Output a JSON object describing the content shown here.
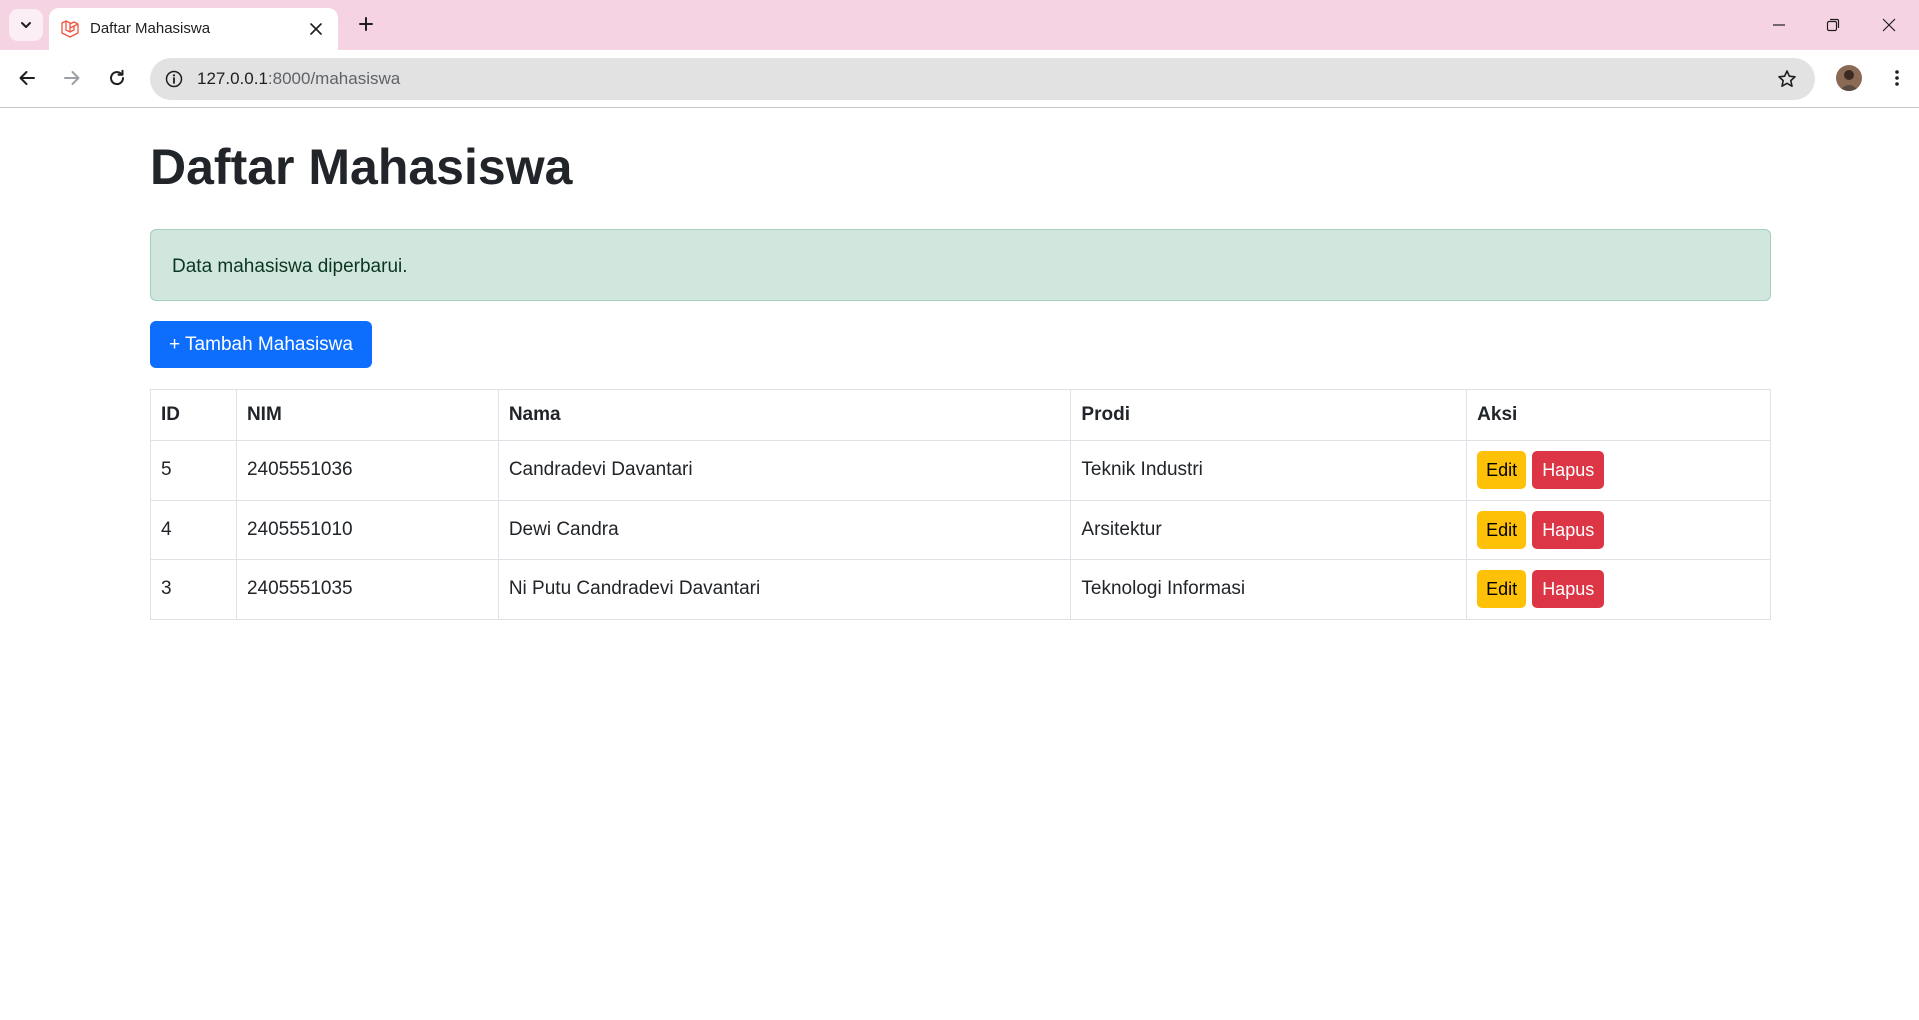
{
  "browser": {
    "tab_title": "Daftar Mahasiswa",
    "url_host": "127.0.0.1",
    "url_path": ":8000/mahasiswa"
  },
  "page": {
    "title": "Daftar Mahasiswa",
    "alert": "Data mahasiswa diperbarui.",
    "add_button": "+ Tambah Mahasiswa"
  },
  "table": {
    "headers": [
      "ID",
      "NIM",
      "Nama",
      "Prodi",
      "Aksi"
    ],
    "rows": [
      {
        "id": "5",
        "nim": "2405551036",
        "nama": "Candradevi Davantari",
        "prodi": "Teknik Industri",
        "edit": "Edit",
        "hapus": "Hapus"
      },
      {
        "id": "4",
        "nim": "2405551010",
        "nama": "Dewi Candra",
        "prodi": "Arsitektur",
        "edit": "Edit",
        "hapus": "Hapus"
      },
      {
        "id": "3",
        "nim": "2405551035",
        "nama": "Ni Putu Candradevi Davantari",
        "prodi": "Teknologi Informasi",
        "edit": "Edit",
        "hapus": "Hapus"
      }
    ]
  },
  "colors": {
    "primary": "#0d6efd",
    "warning": "#ffc107",
    "danger": "#dc3545",
    "success_bg": "#d1e7dd",
    "tabbar_bg": "#f6d3e3"
  },
  "icons": [
    "tab-search-icon",
    "laravel-favicon-icon",
    "close-icon",
    "plus-icon",
    "minimize-icon",
    "restore-icon",
    "window-close-icon",
    "back-icon",
    "forward-icon",
    "reload-icon",
    "site-info-icon",
    "bookmark-star-icon",
    "profile-avatar",
    "kebab-menu-icon"
  ]
}
